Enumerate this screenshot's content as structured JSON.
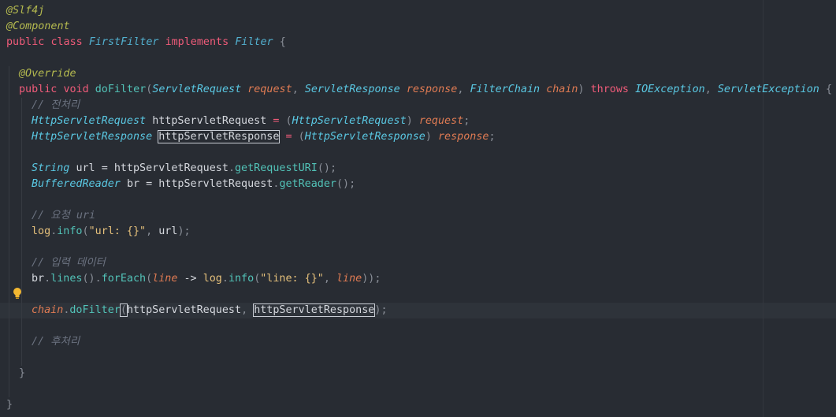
{
  "code": {
    "l1": {
      "ann": "@Slf4j"
    },
    "l2": {
      "ann": "@Component"
    },
    "l3": {
      "kw1": "public",
      "kw2": "class",
      "cls": "FirstFilter",
      "kw3": "implements",
      "iface": "Filter",
      "brace": "{"
    },
    "l5": {
      "ann": "@Override"
    },
    "l6": {
      "kw1": "public",
      "kw2": "void",
      "fn": "doFilter",
      "lp": "(",
      "t1": "ServletRequest",
      "p1": "request",
      "c1": ",",
      "t2": "ServletResponse",
      "p2": "response",
      "c2": ",",
      "t3": "FilterChain",
      "p3": "chain",
      "rp": ")",
      "throws": "throws",
      "e1": "IOException",
      "c3": ",",
      "e2": "ServletException",
      "brace": "{"
    },
    "l7": {
      "comment": "// 전처리"
    },
    "l8": {
      "t": "HttpServletRequest",
      "v": "httpServletRequest",
      "eq": "=",
      "lp": "(",
      "cast": "HttpServletRequest",
      "rp": ")",
      "p": "request",
      "semi": ";"
    },
    "l9": {
      "t": "HttpServletResponse",
      "v": "httpServletResponse",
      "eq": "=",
      "lp": "(",
      "cast": "HttpServletResponse",
      "rp": ")",
      "p": "response",
      "semi": ";"
    },
    "l11": {
      "t": "String",
      "v": "url",
      "eq": "=",
      "obj": "httpServletRequest",
      "dot": ".",
      "m": "getRequestURI",
      "call": "()",
      "semi": ";"
    },
    "l12": {
      "t": "BufferedReader",
      "v": "br",
      "eq": "=",
      "obj": "httpServletRequest",
      "dot": ".",
      "m": "getReader",
      "call": "()",
      "semi": ";"
    },
    "l14": {
      "comment": "// 요청 uri"
    },
    "l15": {
      "obj": "log",
      "dot": ".",
      "m": "info",
      "lp": "(",
      "str": "\"url: {}\"",
      "c": ",",
      "arg": "url",
      "rp": ")",
      "semi": ";"
    },
    "l17": {
      "comment": "// 입력 데이터"
    },
    "l18": {
      "obj": "br",
      "dot1": ".",
      "m1": "lines",
      "call": "()",
      "dot2": ".",
      "m2": "forEach",
      "lp": "(",
      "lp2": "line",
      "arrow": "->",
      "obj2": "log",
      "dot3": ".",
      "m3": "info",
      "lp3": "(",
      "str": "\"line: {}\"",
      "c": ",",
      "arg": "line",
      "rp": "));"
    },
    "l20": {
      "obj": "chain",
      "dot": ".",
      "m": "doFilter",
      "lp": "(",
      "a1": "httpServletRequest",
      "c": ",",
      "a2": "httpServletResponse",
      "rp": ")",
      "semi": ";"
    },
    "l22": {
      "comment": "// 후처리"
    },
    "l24": {
      "brace": "}"
    },
    "l26": {
      "brace": "}"
    }
  },
  "icons": {
    "intention": "lightbulb-icon"
  },
  "colors": {
    "background": "#282c33",
    "keyword": "#ef5b79",
    "type": "#5ac8e3",
    "method": "#52c3b8",
    "param": "#e07b53",
    "annotation": "#b5ba4f",
    "comment": "#6b7280"
  }
}
